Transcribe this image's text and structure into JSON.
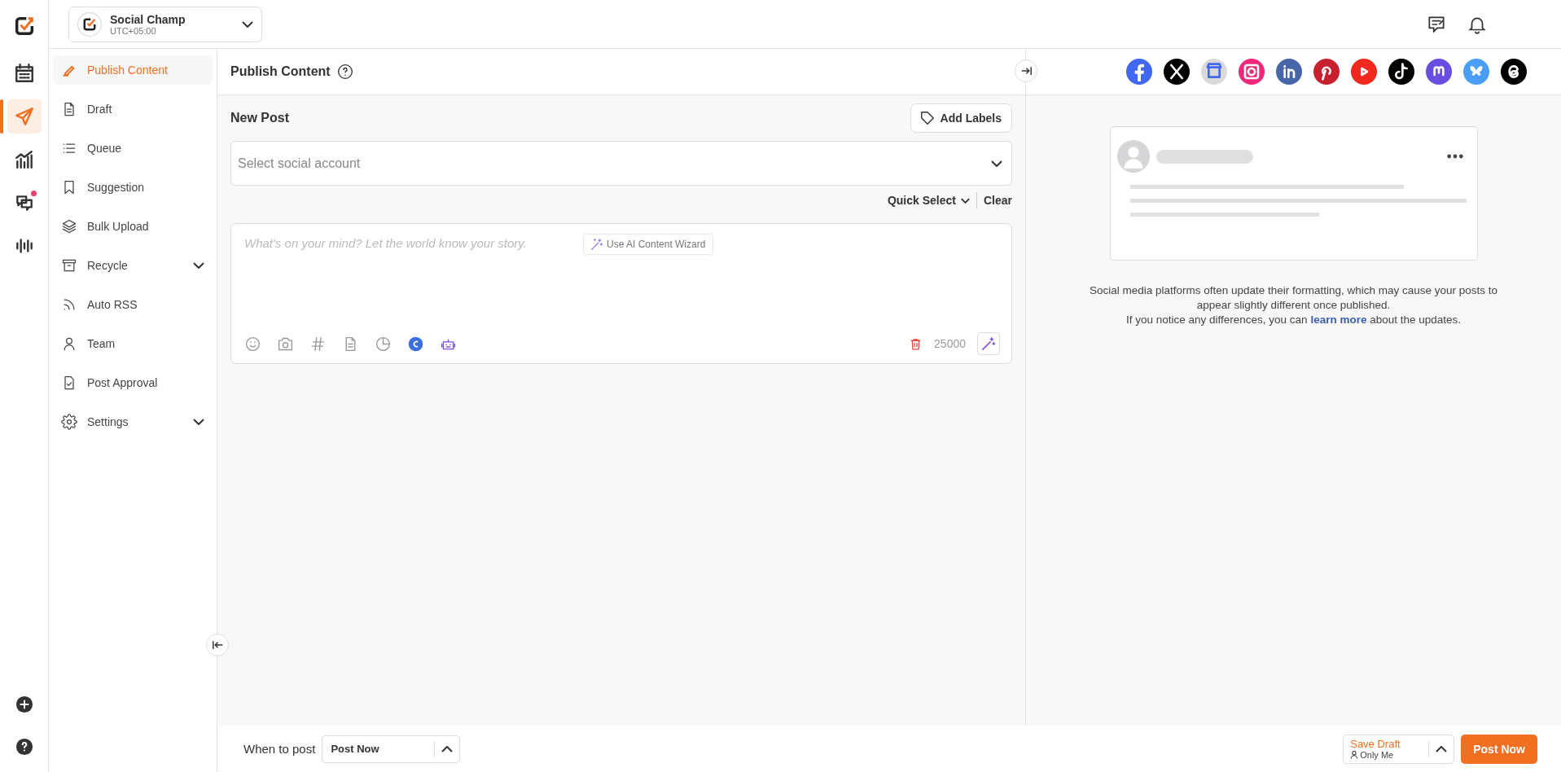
{
  "workspace": {
    "name": "Social Champ",
    "timezone": "UTC+05:00"
  },
  "rail": [
    {
      "kind": "calendar",
      "selected": false,
      "badge": false
    },
    {
      "kind": "send",
      "selected": true,
      "badge": false
    },
    {
      "kind": "chart",
      "selected": false,
      "badge": false
    },
    {
      "kind": "chat",
      "selected": false,
      "badge": true
    },
    {
      "kind": "wave",
      "selected": false,
      "badge": false
    }
  ],
  "rail_bottom": [
    {
      "kind": "plus"
    },
    {
      "kind": "help"
    }
  ],
  "sidebar": {
    "items": [
      {
        "label": "Publish Content",
        "kind": "pencil",
        "selected": true,
        "expandable": false
      },
      {
        "label": "Draft",
        "kind": "document",
        "selected": false,
        "expandable": false
      },
      {
        "label": "Queue",
        "kind": "list",
        "selected": false,
        "expandable": false
      },
      {
        "label": "Suggestion",
        "kind": "bookmark",
        "selected": false,
        "expandable": false
      },
      {
        "label": "Bulk Upload",
        "kind": "layers",
        "selected": false,
        "expandable": false
      },
      {
        "label": "Recycle",
        "kind": "archive",
        "selected": false,
        "expandable": true
      },
      {
        "label": "Auto RSS",
        "kind": "rss",
        "selected": false,
        "expandable": false
      },
      {
        "label": "Team",
        "kind": "person",
        "selected": false,
        "expandable": false
      },
      {
        "label": "Post Approval",
        "kind": "document-check",
        "selected": false,
        "expandable": false
      },
      {
        "label": "Settings",
        "kind": "gear",
        "selected": false,
        "expandable": true
      }
    ]
  },
  "page_title": "Publish Content",
  "new_post": {
    "title": "New Post",
    "add_labels": "Add Labels",
    "account_placeholder": "Select social account",
    "quick_select": "Quick Select",
    "clear": "Clear",
    "composer_placeholder": "What's on your mind? Let the world know your story.",
    "ai_wizard": "Use AI Content Wizard",
    "char_count": "25000",
    "tools": [
      {
        "kind": "smile"
      },
      {
        "kind": "camera"
      },
      {
        "kind": "hash"
      },
      {
        "kind": "document"
      },
      {
        "kind": "pie"
      },
      {
        "kind": "canva"
      },
      {
        "kind": "robot"
      }
    ]
  },
  "networks": [
    {
      "kind": "facebook",
      "color": "#4267f0"
    },
    {
      "kind": "x",
      "color": "#000000"
    },
    {
      "kind": "business",
      "color": "#d9d9d9"
    },
    {
      "kind": "instagram",
      "color": "#f0287a"
    },
    {
      "kind": "linkedin",
      "color": "#4766a9"
    },
    {
      "kind": "pinterest",
      "color": "#c8202f"
    },
    {
      "kind": "youtube",
      "color": "#f0281e"
    },
    {
      "kind": "tiktok",
      "color": "#000000"
    },
    {
      "kind": "mastodon",
      "color": "#6a4ee0"
    },
    {
      "kind": "bluesky",
      "color": "#4b9ef8"
    },
    {
      "kind": "threads",
      "color": "#000000"
    }
  ],
  "preview_note": {
    "line_1": "Social media platforms often update their formatting, which may cause your posts to appear slightly different once published.",
    "line_2_before": "If you notice any differences, you can",
    "link": "learn more",
    "line_2_after": "about the updates."
  },
  "footer": {
    "when_label": "When to post",
    "when_value": "Post Now",
    "save_draft": "Save Draft",
    "visibility": "Only Me",
    "post_now": "Post Now"
  }
}
